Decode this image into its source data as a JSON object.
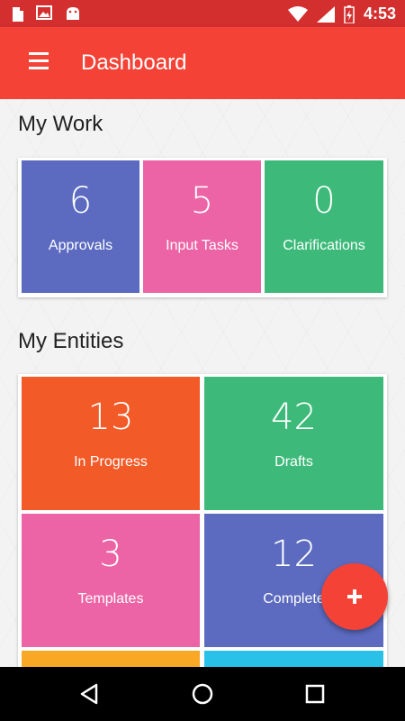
{
  "status_bar": {
    "time": "4:53",
    "icons": [
      "download-icon",
      "image-icon",
      "android-icon",
      "wifi-icon",
      "signal-icon",
      "battery-icon"
    ]
  },
  "app_bar": {
    "title": "Dashboard",
    "menu_icon": "hamburger-menu-icon"
  },
  "my_work": {
    "title": "My Work",
    "tiles": [
      {
        "count": "6",
        "label": "Approvals",
        "color": "#5c6bc0"
      },
      {
        "count": "5",
        "label": "Input Tasks",
        "color": "#ec64a6"
      },
      {
        "count": "0",
        "label": "Clarifications",
        "color": "#3dba7a"
      }
    ]
  },
  "my_entities": {
    "title": "My Entities",
    "tiles": [
      {
        "count": "13",
        "label": "In Progress",
        "color": "#f25a27"
      },
      {
        "count": "42",
        "label": "Drafts",
        "color": "#3dba7a"
      },
      {
        "count": "3",
        "label": "Templates",
        "color": "#ec64a6"
      },
      {
        "count": "12",
        "label": "Complete",
        "color": "#5c6bc0"
      },
      {
        "count": "",
        "label": "",
        "color": "#f9a825"
      },
      {
        "count": "",
        "label": "",
        "color": "#29c1e8"
      }
    ]
  },
  "fab": {
    "icon": "plus-icon",
    "color": "#f44336"
  },
  "nav_bar": {
    "icons": [
      "back-icon",
      "home-icon",
      "recents-icon"
    ]
  },
  "colors": {
    "status_bar": "#d32f2f",
    "app_bar": "#f44336"
  }
}
